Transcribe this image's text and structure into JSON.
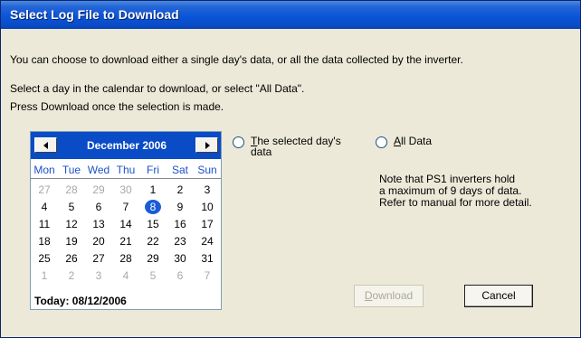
{
  "dialog": {
    "title": "Select Log File to Download",
    "message_line1": "You can choose to download either a single day's data, or all the data collected by the inverter.",
    "message_line2": "Select a day in the calendar to download, or select \"All Data\".",
    "message_line3": "Press Download once the selection is made."
  },
  "calendar": {
    "month_label": "December 2006",
    "weekdays": [
      "Mon",
      "Tue",
      "Wed",
      "Thu",
      "Fri",
      "Sat",
      "Sun"
    ],
    "weeks": [
      [
        {
          "d": "27",
          "muted": true
        },
        {
          "d": "28",
          "muted": true
        },
        {
          "d": "29",
          "muted": true
        },
        {
          "d": "30",
          "muted": true
        },
        {
          "d": "1"
        },
        {
          "d": "2"
        },
        {
          "d": "3"
        }
      ],
      [
        {
          "d": "4"
        },
        {
          "d": "5"
        },
        {
          "d": "6"
        },
        {
          "d": "7"
        },
        {
          "d": "8",
          "selected": true
        },
        {
          "d": "9"
        },
        {
          "d": "10"
        }
      ],
      [
        {
          "d": "11"
        },
        {
          "d": "12"
        },
        {
          "d": "13"
        },
        {
          "d": "14"
        },
        {
          "d": "15"
        },
        {
          "d": "16"
        },
        {
          "d": "17"
        }
      ],
      [
        {
          "d": "18"
        },
        {
          "d": "19"
        },
        {
          "d": "20"
        },
        {
          "d": "21"
        },
        {
          "d": "22"
        },
        {
          "d": "23"
        },
        {
          "d": "24"
        }
      ],
      [
        {
          "d": "25"
        },
        {
          "d": "26"
        },
        {
          "d": "27"
        },
        {
          "d": "28"
        },
        {
          "d": "29"
        },
        {
          "d": "30"
        },
        {
          "d": "31"
        }
      ],
      [
        {
          "d": "1",
          "muted": true
        },
        {
          "d": "2",
          "muted": true
        },
        {
          "d": "3",
          "muted": true
        },
        {
          "d": "4",
          "muted": true
        },
        {
          "d": "5",
          "muted": true
        },
        {
          "d": "6",
          "muted": true
        },
        {
          "d": "7",
          "muted": true
        }
      ]
    ],
    "selected_day": "8",
    "today_label": "Today: 08/12/2006"
  },
  "options": {
    "selected_day_first_letter": "T",
    "selected_day_rest_line1": "he selected day's",
    "selected_day_line2": "data",
    "all_data_first_letter": "A",
    "all_data_rest": "ll Data",
    "selected": "none"
  },
  "note": {
    "line1": "Note that PS1 inverters hold",
    "line2": "a maximum of 9 days of data.",
    "line3": "Refer to manual for more detail."
  },
  "buttons": {
    "download_first_letter": "D",
    "download_rest": "ownload",
    "download_enabled": false,
    "cancel_label": "Cancel"
  },
  "colors": {
    "titlebar": "#0a55d8",
    "calendar_header": "#0a4bc6",
    "weekday_text": "#1c52c8",
    "selected_day": "#1a5cd8",
    "dialog_background": "#ece9d8"
  }
}
